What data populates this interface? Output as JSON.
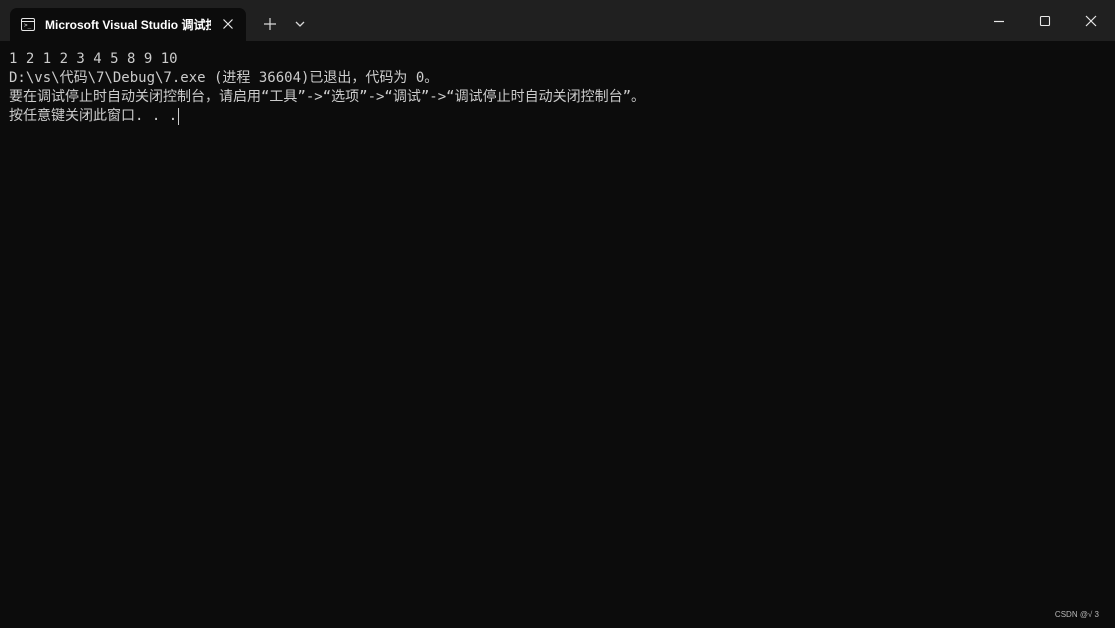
{
  "window": {
    "tab_title": "Microsoft Visual Studio 调试控制台",
    "tab_icon": "terminal-icon",
    "close_tab_icon": "close-icon",
    "new_tab_icon": "plus-icon",
    "dropdown_icon": "chevron-down-icon",
    "controls": {
      "minimize_icon": "minimize-icon",
      "maximize_icon": "maximize-icon",
      "close_icon": "close-icon"
    }
  },
  "console": {
    "lines": [
      "1 2 1 2 3 4 5 8 9 10",
      "D:\\vs\\代码\\7\\Debug\\7.exe (进程 36604)已退出，代码为 0。",
      "要在调试停止时自动关闭控制台，请启用“工具”->“选项”->“调试”->“调试停止时自动关闭控制台”。",
      "按任意键关闭此窗口. . ."
    ]
  },
  "watermark": "CSDN @√ 3",
  "colors": {
    "titlebar": "#202020",
    "background": "#0c0c0c",
    "text": "#cccccc"
  }
}
